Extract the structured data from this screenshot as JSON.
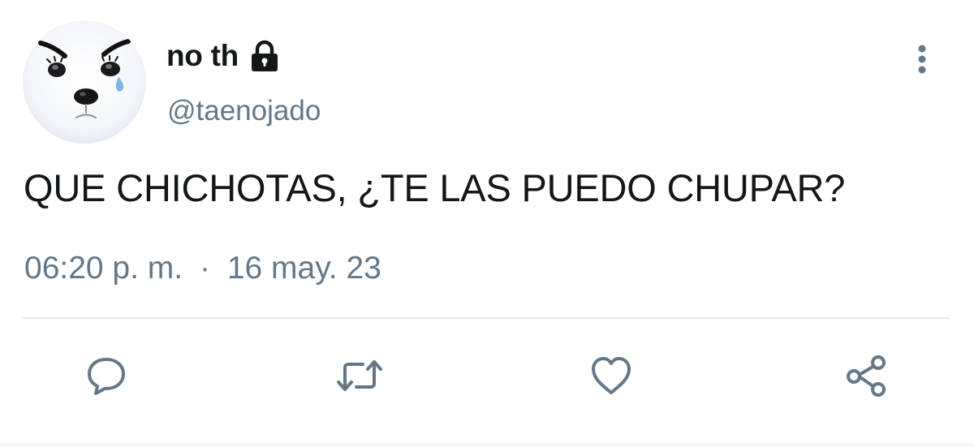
{
  "tweet": {
    "author": {
      "display_name": "no th",
      "handle": "@taenojado",
      "protected": true,
      "avatar_icon": "angry-crying-dog-avatar",
      "lock_icon": "lock-icon"
    },
    "text": "QUE CHICHOTAS, ¿TE LAS PUEDO CHUPAR?",
    "time": "06:20 p. m.",
    "separator": "·",
    "date": "16 may. 23",
    "menu_icon": "more-vertical-icon"
  },
  "actions": [
    {
      "name": "reply",
      "icon": "comment-bubble-icon"
    },
    {
      "name": "retweet",
      "icon": "retweet-icon"
    },
    {
      "name": "like",
      "icon": "heart-icon"
    },
    {
      "name": "share",
      "icon": "share-icon"
    }
  ],
  "colors": {
    "text_primary": "#14171a",
    "text_secondary": "#657786",
    "icon": "#657786",
    "divider": "#e1e8ed"
  }
}
